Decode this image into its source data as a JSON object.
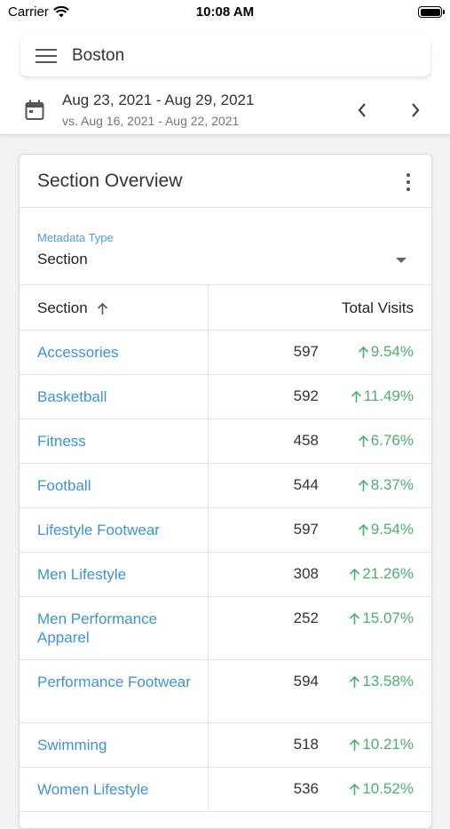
{
  "status_bar": {
    "carrier": "Carrier",
    "time": "10:08 AM"
  },
  "header": {
    "location": "Boston",
    "date_range": "Aug 23, 2021 - Aug 29, 2021",
    "compare_range": "vs. Aug 16, 2021 - Aug 22, 2021"
  },
  "card": {
    "title": "Section Overview",
    "metadata_label": "Metadata Type",
    "metadata_value": "Section"
  },
  "table": {
    "col_section": "Section",
    "col_visits": "Total Visits",
    "rows": [
      {
        "label": "Accessories",
        "count": "597",
        "change": "9.54%"
      },
      {
        "label": "Basketball",
        "count": "592",
        "change": "11.49%"
      },
      {
        "label": "Fitness",
        "count": "458",
        "change": "6.76%"
      },
      {
        "label": "Football",
        "count": "544",
        "change": "8.37%"
      },
      {
        "label": "Lifestyle Footwear",
        "count": "597",
        "change": "9.54%"
      },
      {
        "label": "Men Lifestyle",
        "count": "308",
        "change": "21.26%"
      },
      {
        "label": "Men Performance Apparel",
        "count": "252",
        "change": "15.07%"
      },
      {
        "label": "Performance Footwear",
        "count": "594",
        "change": "13.58%"
      },
      {
        "label": "Swimming",
        "count": "518",
        "change": "10.21%"
      },
      {
        "label": "Women Lifestyle",
        "count": "536",
        "change": "10.52%"
      }
    ]
  },
  "colors": {
    "link_blue": "#3d93d3",
    "label_blue": "#4aa0d6",
    "positive_green": "#4caf6e"
  }
}
